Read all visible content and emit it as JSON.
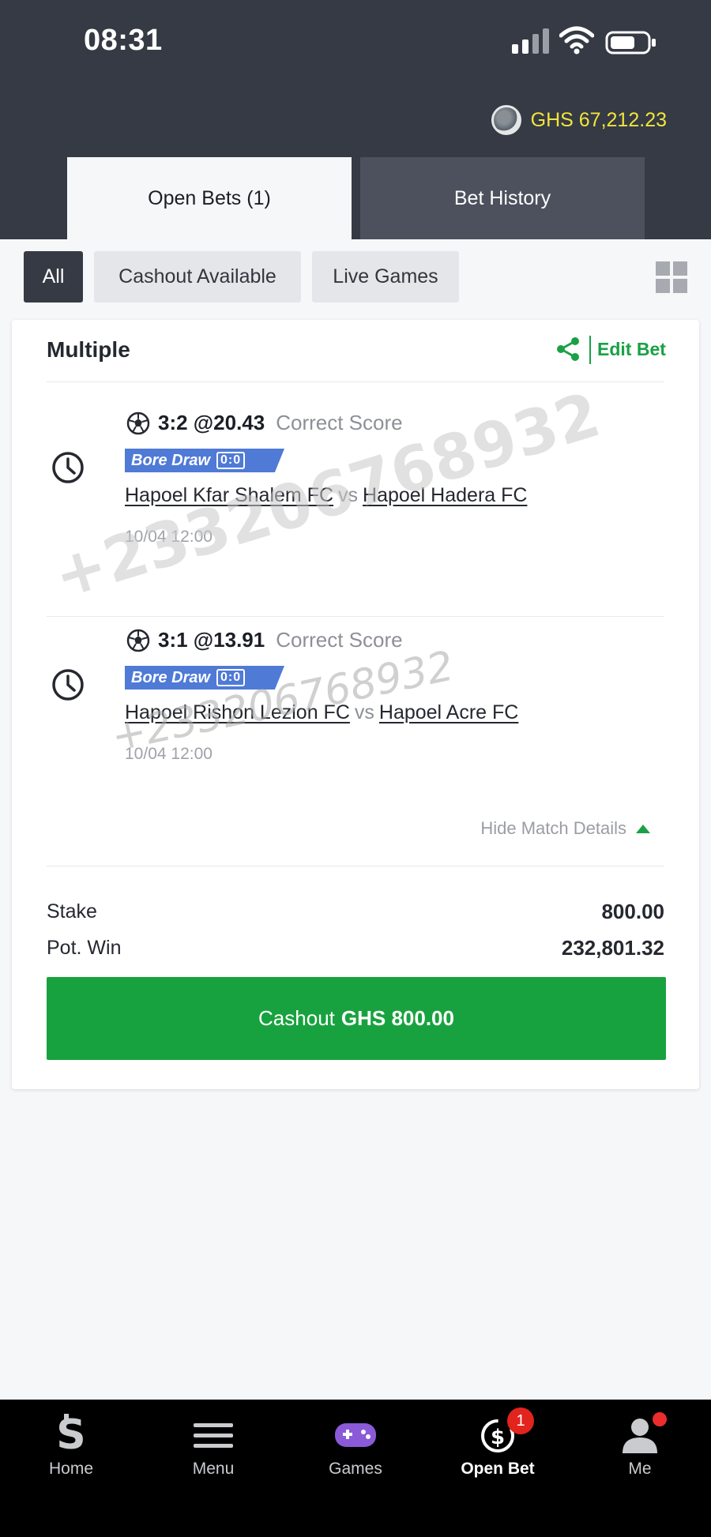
{
  "status_bar": {
    "time": "08:31"
  },
  "account": {
    "balance": "GHS 67,212.23"
  },
  "tabs": [
    {
      "label": "Open Bets (1)",
      "active": true
    },
    {
      "label": "Bet History",
      "active": false
    }
  ],
  "filters": [
    {
      "label": "All",
      "selected": true
    },
    {
      "label": "Cashout Available",
      "selected": false
    },
    {
      "label": "Live Games",
      "selected": false
    }
  ],
  "bet": {
    "type": "Multiple",
    "edit_label": "Edit Bet",
    "selections": [
      {
        "pick": "3:2 @20.43",
        "market": "Correct Score",
        "badge": "Bore Draw",
        "badge_score": "0:0",
        "home": "Hapoel Kfar Shalem FC",
        "vs": "vs",
        "away": "Hapoel Hadera FC",
        "date": "10/04 12:00"
      },
      {
        "pick": "3:1 @13.91",
        "market": "Correct Score",
        "badge": "Bore Draw",
        "badge_score": "0:0",
        "home": "Hapoel Rishon Lezion FC",
        "vs": "vs",
        "away": "Hapoel Acre FC",
        "date": "10/04 12:00"
      }
    ],
    "hide_details_label": "Hide Match Details",
    "stake_label": "Stake",
    "stake_value": "800.00",
    "pot_win_label": "Pot. Win",
    "pot_win_value": "232,801.32",
    "cashout_label": "Cashout",
    "cashout_amount": "GHS 800.00"
  },
  "watermark": "+233206768932",
  "bottom_nav": [
    {
      "label": "Home",
      "icon": "sportybet-logo-icon"
    },
    {
      "label": "Menu",
      "icon": "menu-icon"
    },
    {
      "label": "Games",
      "icon": "gamepad-icon"
    },
    {
      "label": "Open Bet",
      "icon": "open-bet-icon",
      "badge": "1",
      "active": true
    },
    {
      "label": "Me",
      "icon": "user-icon"
    }
  ],
  "colors": {
    "header_bg": "#353a45",
    "balance_yellow": "#f3e43a",
    "accent_green": "#18a23f",
    "badge_blue": "#4f7ad6",
    "notification_red": "#e1241d"
  }
}
